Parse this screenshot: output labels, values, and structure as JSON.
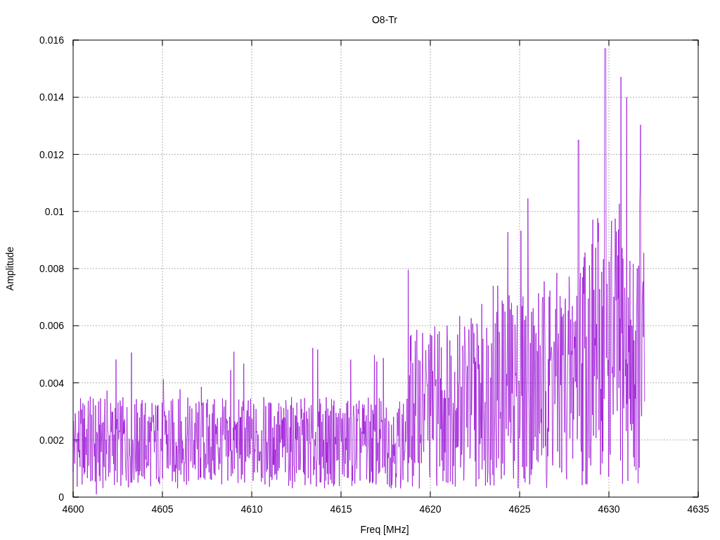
{
  "title": "O8-Tr",
  "xlabel": "Freq [MHz]",
  "ylabel": "Amplitude",
  "xticks": [
    "4600",
    "4605",
    "4610",
    "4615",
    "4620",
    "4625",
    "4630",
    "4635"
  ],
  "yticks": [
    "0.016",
    "0.014",
    "0.012",
    "0.01",
    "0.008",
    "0.006",
    "0.004",
    "0.002",
    "0"
  ]
}
